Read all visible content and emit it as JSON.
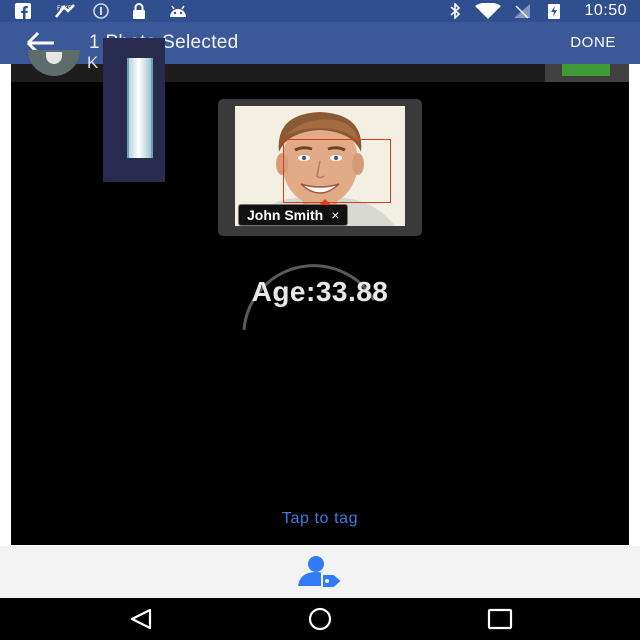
{
  "status_bar": {
    "time": "10:50",
    "icons": [
      "facebook-icon",
      "fake-gps-icon",
      "info-icon",
      "lock-icon",
      "android-icon",
      "bluetooth-icon",
      "wifi-icon",
      "no-signal-icon",
      "battery-charging-icon"
    ]
  },
  "toolbar": {
    "title": "1 Photo Selected",
    "done_label": "DONE"
  },
  "photo": {
    "owner_initial": "K",
    "tag_name": "John Smith",
    "tag_remove": "×",
    "age_label": "Age:33.88",
    "tap_to_tag": "Tap to tag"
  },
  "colors": {
    "toolbar": "#3b5998",
    "status_bar": "#2f4f8f",
    "accent_blue": "#3b7de0",
    "face_box": "#e03a1e"
  }
}
